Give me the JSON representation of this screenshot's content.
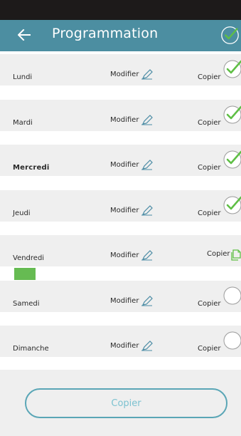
{
  "header": {
    "title": "Programmation"
  },
  "days": [
    {
      "label": "Lundi",
      "modify": "Modifier",
      "copy": "Copier",
      "state": "checked"
    },
    {
      "label": "Mardi",
      "modify": "Modifier",
      "copy": "Copier",
      "state": "checked"
    },
    {
      "label": "Mercredi",
      "modify": "Modifier",
      "copy": "Copier",
      "state": "checked"
    },
    {
      "label": "Jeudi",
      "modify": "Modifier",
      "copy": "Copier",
      "state": "checked"
    },
    {
      "label": "Vendredi",
      "modify": "Modifier",
      "copy": "Copier",
      "state": "source"
    },
    {
      "label": "Samedi",
      "modify": "Modifier",
      "copy": "Copier",
      "state": "unchecked"
    },
    {
      "label": "Dimanche",
      "modify": "Modifier",
      "copy": "Copier",
      "state": "unchecked"
    }
  ],
  "footer": {
    "copy_button": "Copier"
  },
  "colors": {
    "header": "#4c8ea1",
    "check": "#5fbf45",
    "button_border": "#5aa6b6"
  },
  "icons": {
    "back": "arrow-left-icon",
    "header_check": "check-circle-icon",
    "modify": "pencil-icon",
    "copy_source": "copy-document-icon"
  }
}
